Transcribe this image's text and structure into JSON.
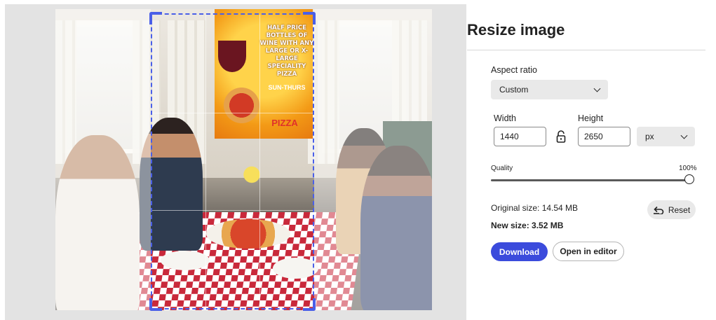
{
  "poster": {
    "text": "HALF PRICE BOTTLES OF WINE WITH ANY LARGE OR X-LARGE SPECIALITY PIZZA",
    "days": "SUN-THURS",
    "brand": "PIZZA"
  },
  "panel": {
    "title": "Resize image",
    "aspect_ratio": {
      "label": "Aspect ratio",
      "value": "Custom"
    },
    "width": {
      "label": "Width",
      "value": "1440"
    },
    "height": {
      "label": "Height",
      "value": "2650"
    },
    "unit": {
      "value": "px"
    },
    "quality": {
      "label": "Quality",
      "value_label": "100%",
      "value": 1.0
    },
    "original_size": "Original size:  14.54 MB",
    "new_size": "New size:  3.52 MB",
    "reset_label": "Reset",
    "download_label": "Download",
    "open_editor_label": "Open in editor"
  },
  "icons": {
    "lock": "unlock-icon",
    "reset": "undo-icon",
    "dropdown": "chevron-down-icon"
  },
  "colors": {
    "accent": "#3b4bdc",
    "crop_border": "#4a5fe8"
  }
}
